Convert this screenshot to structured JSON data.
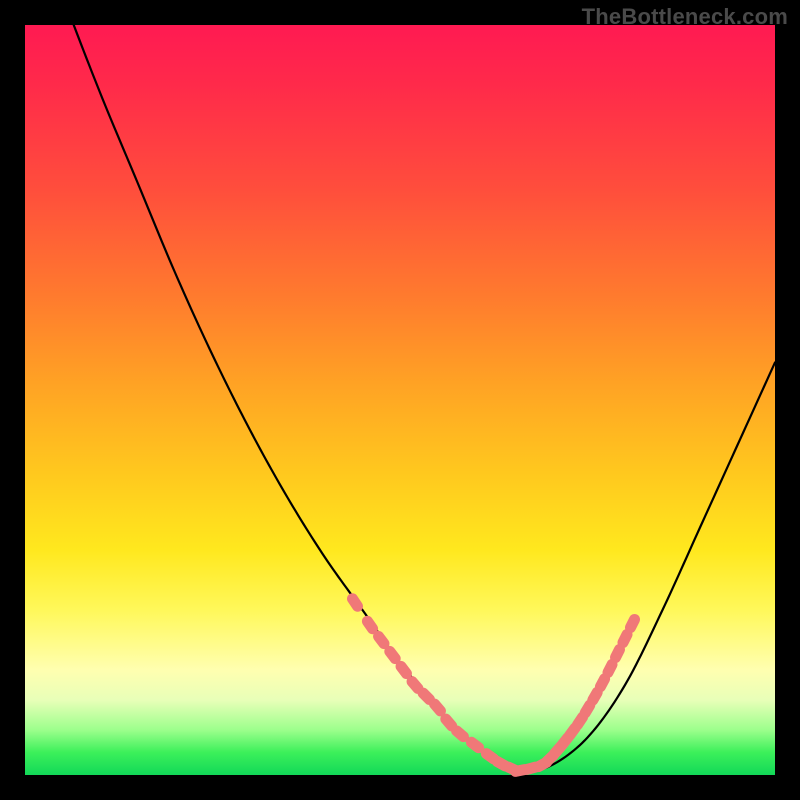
{
  "watermark": "TheBottleneck.com",
  "colors": {
    "background": "#000000",
    "curve": "#000000",
    "markers": "#f07878",
    "gradient_top": "#ff1a52",
    "gradient_bottom": "#12d858"
  },
  "chart_data": {
    "type": "line",
    "title": "",
    "xlabel": "",
    "ylabel": "",
    "xlim": [
      0,
      100
    ],
    "ylim": [
      0,
      100
    ],
    "x": [
      0,
      5,
      10,
      15,
      20,
      25,
      30,
      35,
      40,
      45,
      50,
      55,
      60,
      63,
      66,
      70,
      75,
      80,
      85,
      90,
      95,
      100
    ],
    "values": [
      118,
      104,
      91,
      79,
      67,
      56,
      46,
      37,
      29,
      22,
      15,
      9,
      4,
      1.5,
      0.6,
      1.2,
      5,
      12,
      22,
      33,
      44,
      55
    ],
    "series": [
      {
        "name": "bottleneck-curve",
        "x": [
          0,
          5,
          10,
          15,
          20,
          25,
          30,
          35,
          40,
          45,
          50,
          55,
          60,
          63,
          66,
          70,
          75,
          80,
          85,
          90,
          95,
          100
        ],
        "y": [
          118,
          104,
          91,
          79,
          67,
          56,
          46,
          37,
          29,
          22,
          15,
          9,
          4,
          1.5,
          0.6,
          1.2,
          5,
          12,
          22,
          33,
          44,
          55
        ]
      }
    ],
    "markers": {
      "left_cluster": {
        "x": [
          44,
          46,
          47.5,
          49,
          50.5,
          52,
          53.5,
          55,
          56.5,
          58,
          60,
          62,
          63.5,
          65
        ],
        "y": [
          23,
          20,
          18,
          16,
          14,
          12,
          10.5,
          9,
          7,
          5.5,
          4,
          2.5,
          1.5,
          0.8
        ]
      },
      "right_cluster": {
        "x": [
          66,
          67.5,
          69,
          70,
          71,
          72,
          73,
          74,
          75,
          76,
          77,
          78,
          79,
          80,
          81
        ],
        "y": [
          0.6,
          0.9,
          1.4,
          2.2,
          3.3,
          4.5,
          5.8,
          7.2,
          8.8,
          10.5,
          12.3,
          14.2,
          16.2,
          18.2,
          20.2
        ]
      }
    }
  }
}
